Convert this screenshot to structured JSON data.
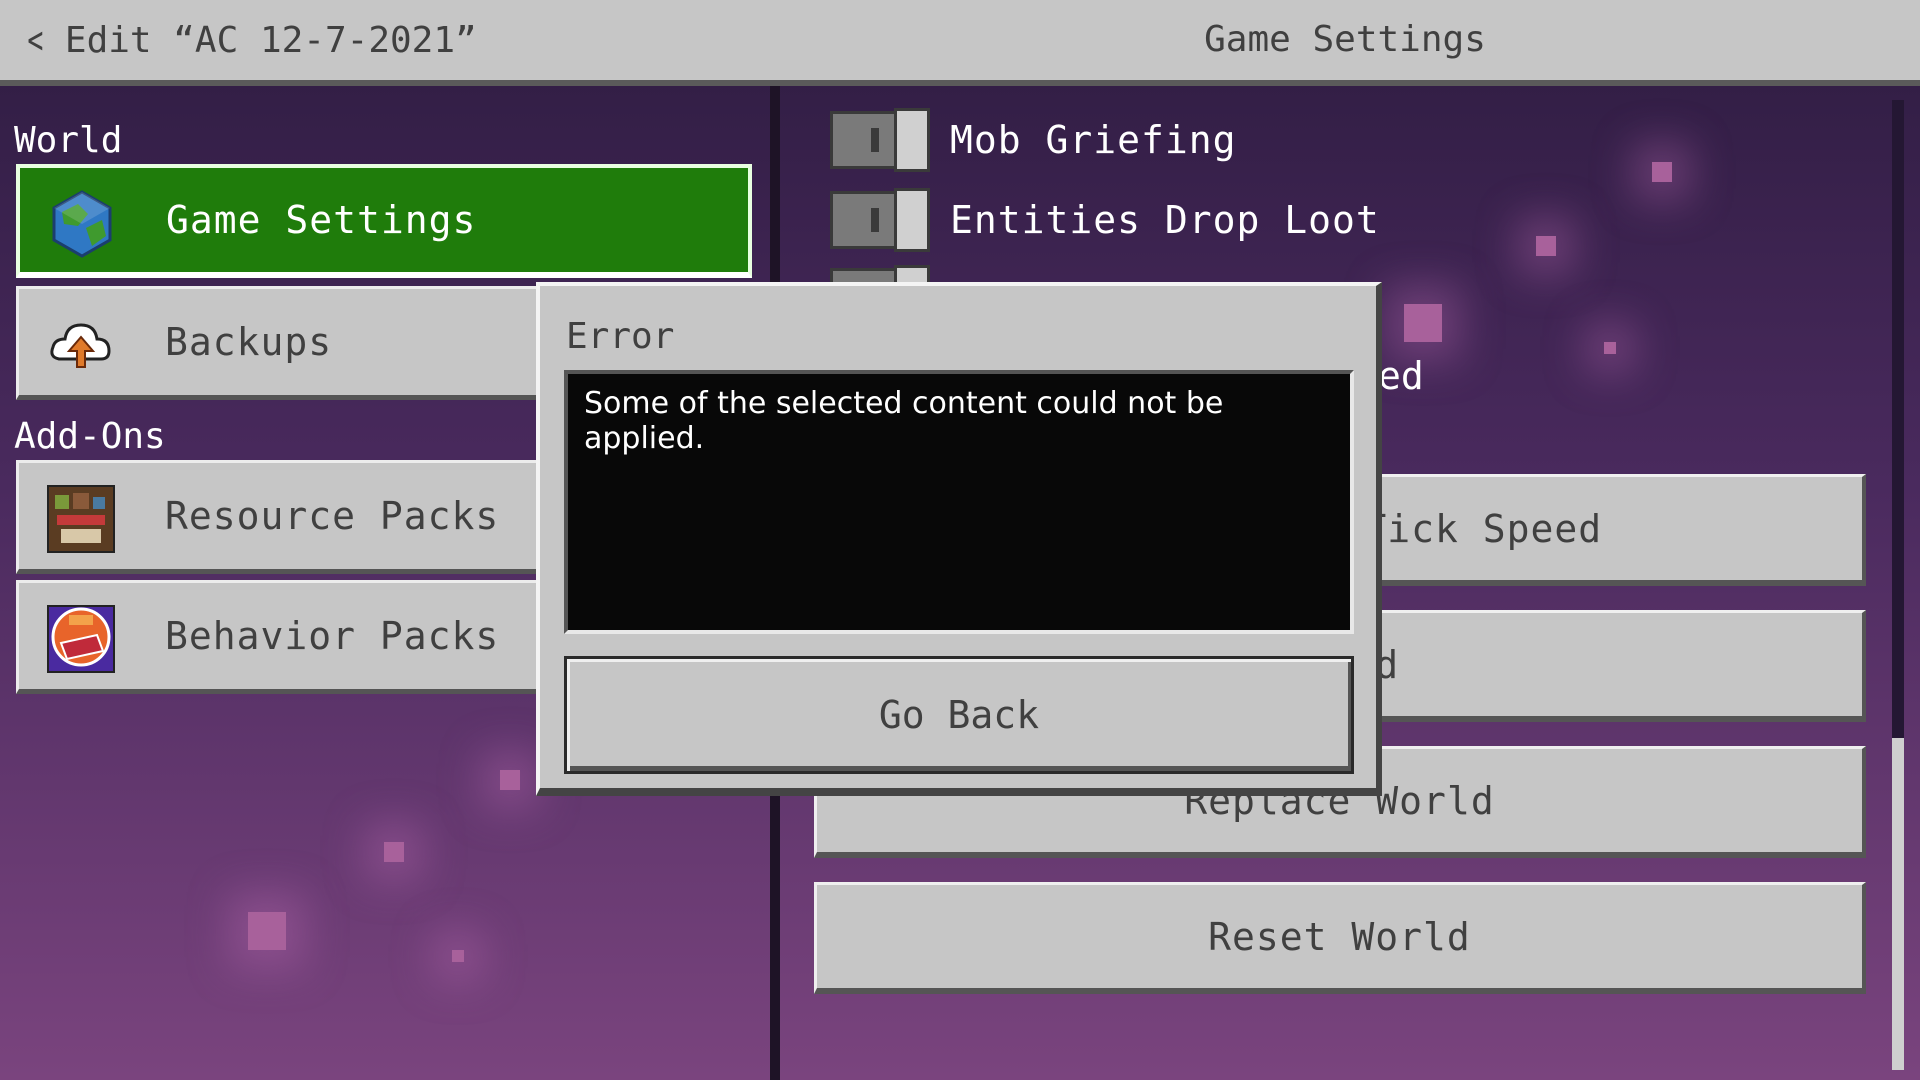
{
  "header": {
    "back_label": "Edit “AC 12-7-2021”",
    "title": "Game Settings"
  },
  "sidebar": {
    "world_heading": "World",
    "addons_heading": "Add-Ons",
    "items": [
      {
        "label": "Game Settings",
        "icon": "globe-icon",
        "active": true
      },
      {
        "label": "Backups",
        "icon": "cloud-upload-icon"
      },
      {
        "label": "Resource Packs",
        "icon": "resource-pack-icon"
      },
      {
        "label": "Behavior Packs",
        "icon": "behavior-pack-icon"
      }
    ]
  },
  "settings": {
    "toggles": [
      {
        "label": "Mob Griefing",
        "on": false
      },
      {
        "label": "Entities Drop Loot",
        "on": false
      }
    ],
    "partial_label": "ed",
    "buttons": [
      "eset Random Tick Speed",
      "Jorld",
      "Replace World",
      "Reset World"
    ]
  },
  "dialog": {
    "title": "Error",
    "message": "Some of the selected content could not be applied.",
    "button": "Go Back"
  },
  "colors": {
    "active_green": "#1f7c0b",
    "panel_gray": "#c6c6c6",
    "text_dark": "#404040"
  }
}
